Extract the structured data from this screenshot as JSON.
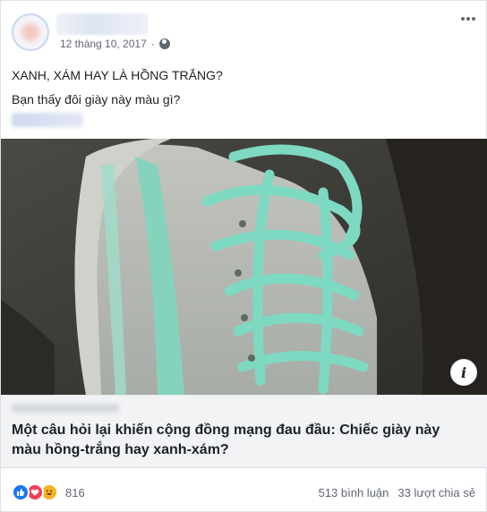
{
  "post": {
    "date": "12 tháng 10, 2017",
    "dot": "·",
    "line1": "XANH, XÁM HAY LÀ HỒNG TRẮNG?",
    "line2": "Bạn thấy đôi giày này màu gì?"
  },
  "photo": {
    "info_label": "i"
  },
  "link": {
    "title": "Một câu hỏi lại khiến cộng đồng mạng đau đầu: Chiếc giày này màu hồng-trắng hay xanh-xám?"
  },
  "footer": {
    "reaction_count": "816",
    "comments": "513 bình luận",
    "shares": "33 lượt chia sẻ"
  },
  "colors": {
    "lace": "#7ed9c3",
    "shoe_body": "#b9bdb5",
    "background": "#3b3b36",
    "like": "#1877f2",
    "love": "#f33e58",
    "haha": "#f7b125"
  }
}
